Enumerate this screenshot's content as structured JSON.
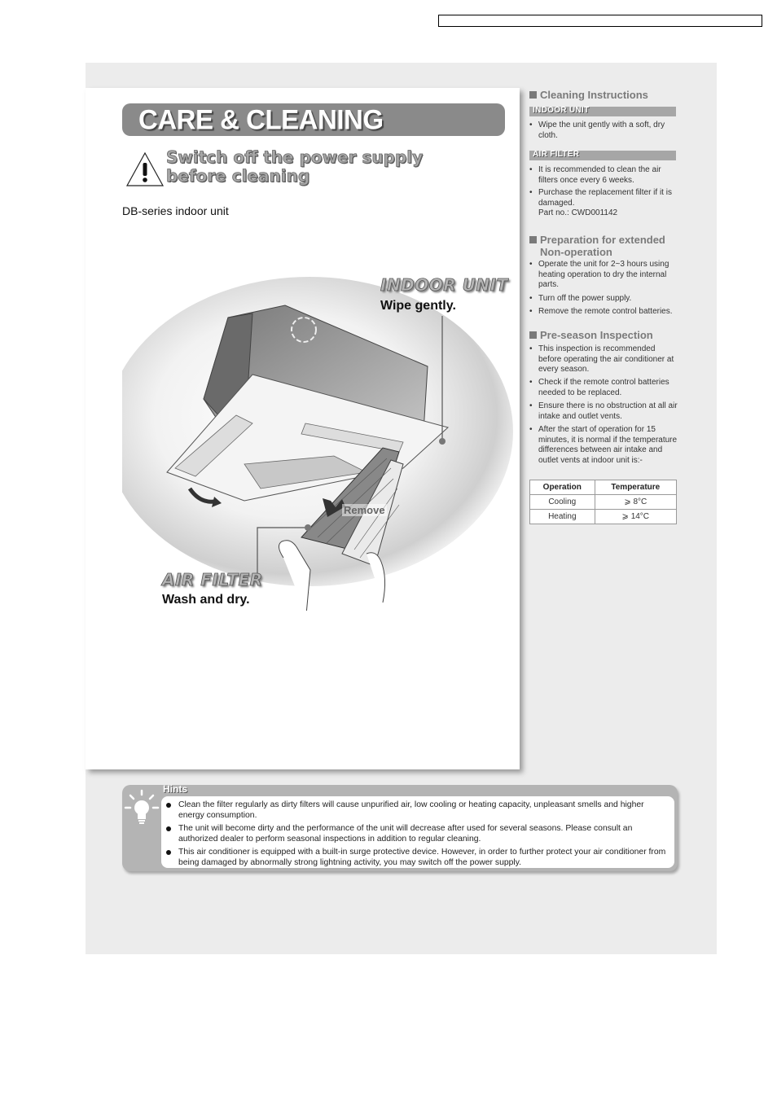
{
  "header_box_text": "",
  "title": "CARE & CLEANING",
  "warning": {
    "icon": "warning-triangle-icon",
    "line1": "Switch off the power supply",
    "line2": "before cleaning"
  },
  "subtitle": "DB-series indoor unit",
  "illustration": {
    "indoor_unit": {
      "title": "INDOOR UNIT",
      "instruction": "Wipe gently."
    },
    "air_filter": {
      "title": "AIR FILTER",
      "instruction": "Wash and dry."
    },
    "remove_label": "Remove"
  },
  "right_column": {
    "cleaning": {
      "title": "Cleaning Instructions",
      "indoor_unit": {
        "label": "INDOOR UNIT",
        "items": [
          "Wipe the unit gently with a soft, dry cloth."
        ]
      },
      "air_filter": {
        "label": "AIR FILTER",
        "items": [
          "It is recommended to clean the air filters once every 6 weeks.",
          "Purchase the replacement filter if it is damaged.",
          "Part no.: CWD001142"
        ]
      }
    },
    "preparation": {
      "title_line1": "Preparation for extended",
      "title_line2": "Non-operation",
      "items": [
        "Operate the unit for 2~3 hours using heating operation to dry the internal parts.",
        "Turn off the power supply.",
        "Remove the remote control batteries."
      ]
    },
    "preseason": {
      "title": "Pre-season Inspection",
      "items": [
        "This inspection is recommended before operating the air conditioner at every season.",
        "Check if the remote control batteries needed to be replaced.",
        "Ensure there is no obstruction at all air intake and outlet vents.",
        "After the start of operation for 15 minutes, it is normal if the temperature differences between air intake and outlet vents at indoor unit is:-"
      ],
      "table": {
        "headers": [
          "Operation",
          "Temperature"
        ],
        "rows": [
          [
            "Cooling",
            "⩾ 8°C"
          ],
          [
            "Heating",
            "⩾ 14°C"
          ]
        ]
      }
    }
  },
  "hints": {
    "title": "Hints",
    "icon": "lightbulb-icon",
    "items": [
      "Clean the filter regularly as dirty filters will cause unpurified air, low cooling or heating capacity, unpleasant smells and higher energy consumption.",
      "The unit will become dirty and the performance of the unit will decrease after used for several seasons. Please consult an authorized dealer to perform seasonal inspections in addition to regular cleaning.",
      "This air conditioner is equipped with a built-in surge protective device. However, in order to further protect your air conditioner from being damaged by abnormally strong lightning activity, you may switch off the power supply."
    ]
  }
}
